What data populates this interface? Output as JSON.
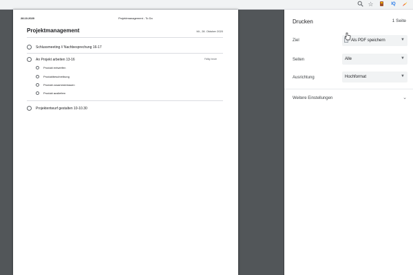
{
  "toolbar": {
    "icons": [
      "zoom-icon",
      "star-icon",
      "extension-brown-icon",
      "extension-iq-icon",
      "extension-feather-icon"
    ],
    "iq_label": "IQ"
  },
  "document": {
    "header_date": "28.10.2020",
    "header_title": "Projektmanagement - To Do",
    "title": "Projektmanagement",
    "date": "Mi., 28. Oktober 2020",
    "tasks": [
      {
        "label": "Schlussmeeting // Nachbesprechung 16-17"
      },
      {
        "label": "An Projekt arbeiten 13-16",
        "due": "Fällig heute",
        "subtasks": [
          "Produkt entwerfen",
          "Produktbeschreibung",
          "Produkt zusammenbauen",
          "Produkt ausliefern"
        ]
      },
      {
        "label": "Projektentwurf gestalten 10-10.30"
      }
    ]
  },
  "print_panel": {
    "title": "Drucken",
    "sheet_count": "1 Seite",
    "destination": {
      "label": "Ziel",
      "value": "Als PDF speichern"
    },
    "pages": {
      "label": "Seiten",
      "value": "Alle"
    },
    "layout": {
      "label": "Ausrichtung",
      "value": "Hochformat"
    },
    "more_settings": "Weitere Einstellungen"
  }
}
